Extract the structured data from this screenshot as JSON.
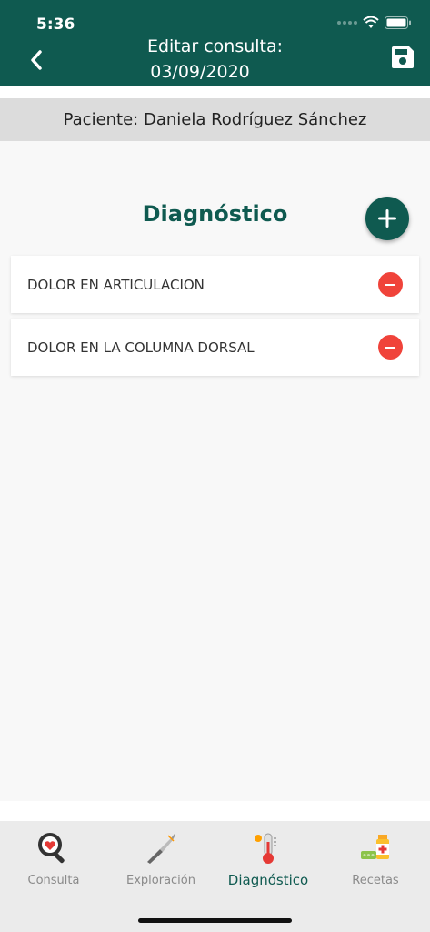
{
  "status_bar": {
    "time": "5:36"
  },
  "header": {
    "title_line1": "Editar consulta:",
    "title_line2": "03/09/2020",
    "back_icon": "chevron-left-icon",
    "save_icon": "floppy-disk-icon"
  },
  "patient": {
    "label": "Paciente: Daniela Rodríguez Sánchez"
  },
  "section": {
    "title": "Diagnóstico",
    "add_icon": "plus-icon"
  },
  "diagnoses": [
    {
      "label": "DOLOR EN ARTICULACION"
    },
    {
      "label": "DOLOR EN LA COLUMNA DORSAL"
    }
  ],
  "tabs": [
    {
      "label": "Consulta",
      "icon": "magnifier-heart-icon"
    },
    {
      "label": "Exploración",
      "icon": "scalpel-icon"
    },
    {
      "label": "Diagnóstico",
      "icon": "thermometer-icon"
    },
    {
      "label": "Recetas",
      "icon": "medicine-icon"
    }
  ],
  "colors": {
    "primary": "#0f5a50",
    "danger": "#f0433a",
    "tab_inactive": "#8a8a8a"
  }
}
